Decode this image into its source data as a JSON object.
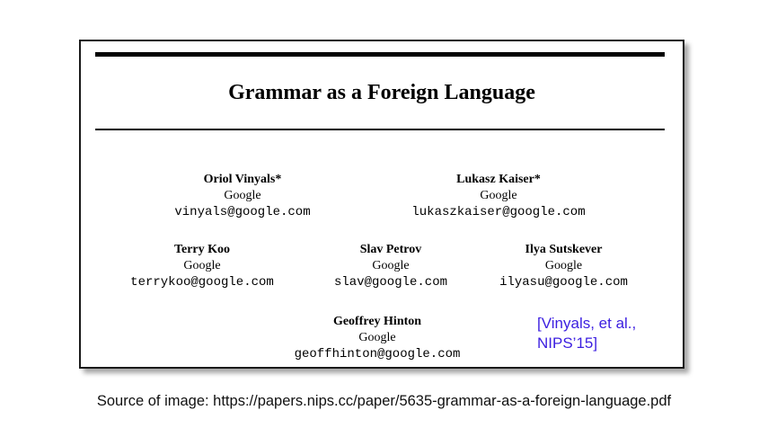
{
  "paper": {
    "title": "Grammar as a Foreign Language",
    "authors": [
      {
        "name": "Oriol Vinyals*",
        "affiliation": "Google",
        "email": "vinyals@google.com"
      },
      {
        "name": "Lukasz Kaiser*",
        "affiliation": "Google",
        "email": "lukaszkaiser@google.com"
      },
      {
        "name": "Terry Koo",
        "affiliation": "Google",
        "email": "terrykoo@google.com"
      },
      {
        "name": "Slav Petrov",
        "affiliation": "Google",
        "email": "slav@google.com"
      },
      {
        "name": "Ilya Sutskever",
        "affiliation": "Google",
        "email": "ilyasu@google.com"
      },
      {
        "name": "Geoffrey Hinton",
        "affiliation": "Google",
        "email": "geoffhinton@google.com"
      }
    ]
  },
  "citation": {
    "line1": "[Vinyals, et al.,",
    "line2": "NIPS’15]",
    "color": "#3b1ee0"
  },
  "source": "Source of image: https://papers.nips.cc/paper/5635-grammar-as-a-foreign-language.pdf"
}
